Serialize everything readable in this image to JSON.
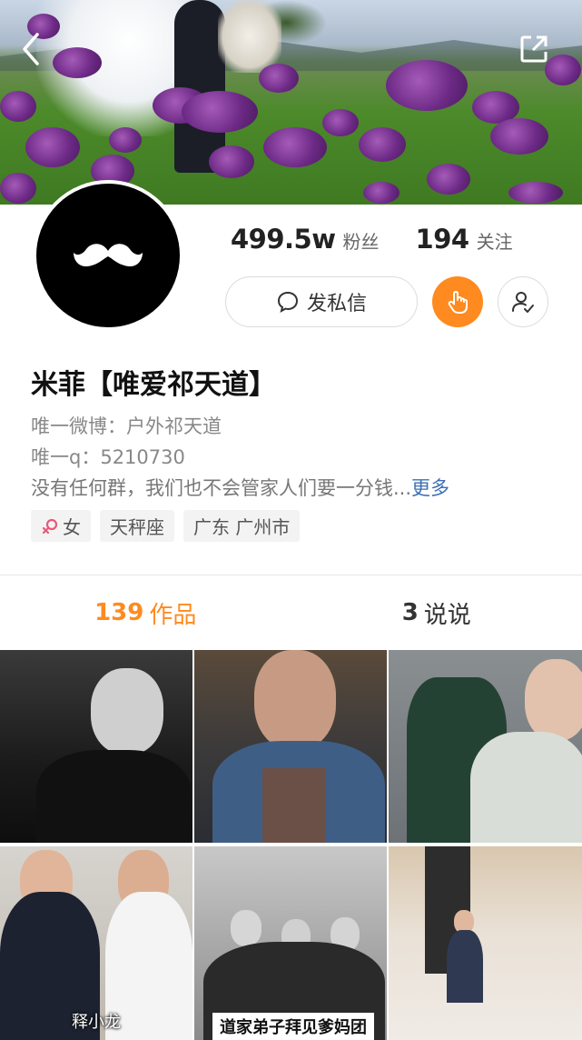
{
  "profile": {
    "followers_count": "499.5w",
    "followers_label": "粉丝",
    "following_count": "194",
    "following_label": "关注",
    "message_button": "发私信",
    "name": "米菲【唯爱祁天道】",
    "bio_line1": "唯一微博：户外祁天道",
    "bio_line2": "唯一q：5210730",
    "bio_line3": "没有任何群，我们也不会管家人们要一分钱...",
    "more_link": "更多",
    "tags": {
      "gender": "女",
      "zodiac": "天秤座",
      "location": "广东 广州市"
    }
  },
  "tabs": {
    "works_count": "139",
    "works_label": "作品",
    "posts_count": "3",
    "posts_label": "说说"
  },
  "thumbnails": {
    "caption_4": "释小龙",
    "caption_5": "道家弟子拜见爹妈团"
  },
  "icons": {
    "back": "chevron-left-icon",
    "share": "share-icon",
    "mustache": "mustache-icon",
    "chat": "chat-bubble-icon",
    "hand": "hand-tap-icon",
    "follow": "user-check-icon",
    "female": "female-icon"
  },
  "colors": {
    "accent": "#ff8a1f",
    "link": "#3b6fb6",
    "female": "#e85a7a"
  }
}
